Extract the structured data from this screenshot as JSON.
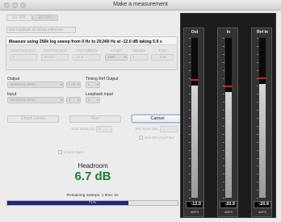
{
  "window": {
    "title": "Make a measurement"
  },
  "top_buttons": {
    "left": "1/1 SPL",
    "right": "2/2 SPL"
  },
  "timing_checkbox": "Use loopback as timing reference",
  "measure": {
    "header": "Measure using 256k log sweep from 0 Hz to 20,000 Hz at -12.0 dB taking 5.9 s",
    "fields": [
      {
        "label": "Start Freq (Hz)",
        "value": "0"
      },
      {
        "label": "End Freq (Hz)",
        "value": "20,000"
      },
      {
        "label": "Level (dBFS)",
        "value": "-12.0"
      },
      {
        "label": "Length",
        "value": "256k"
      },
      {
        "label": "Sweeps",
        "value": "1"
      },
      {
        "label": "Time",
        "value": "5.9s"
      }
    ]
  },
  "io": {
    "output_label": "Output",
    "output_device": "Steinberg UR44",
    "output_channel": "L+R",
    "timing_ref_label": "Timing Ref Output",
    "timing_ref_value": "L",
    "input_label": "Input",
    "input_device": "Steinberg UR44",
    "input_channel": "1",
    "loopback_label": "Loopback input",
    "loopback_value": "2"
  },
  "actions": {
    "check_levels": "Check Levels",
    "start": "Start",
    "cancel": "Cancel",
    "start_delay_label": "Start Delay (s)",
    "start_delay_value": "0",
    "spl_label": "SPL level (dB)",
    "spl_value": "",
    "spl_cal": "Use SPL/Cal Files",
    "check_open": "Check Open"
  },
  "headroom": {
    "label": "Headroom",
    "value": "6.7 dB"
  },
  "status": {
    "remaining": "Remaining sweeps: 1  time: 2s",
    "progress_text": "71%",
    "progress_fraction": 0.71
  },
  "meters": [
    {
      "name": "Out",
      "value": "-12.0",
      "unit": "dBFS",
      "level": 0.7,
      "peak": 0.73
    },
    {
      "name": "In",
      "value": "-20.9",
      "unit": "dBFS",
      "level": 0.66,
      "peak": 0.69
    },
    {
      "name": "Ref In",
      "value": "-20.9",
      "unit": "dBFS",
      "level": 0.71,
      "peak": 0.74
    }
  ]
}
